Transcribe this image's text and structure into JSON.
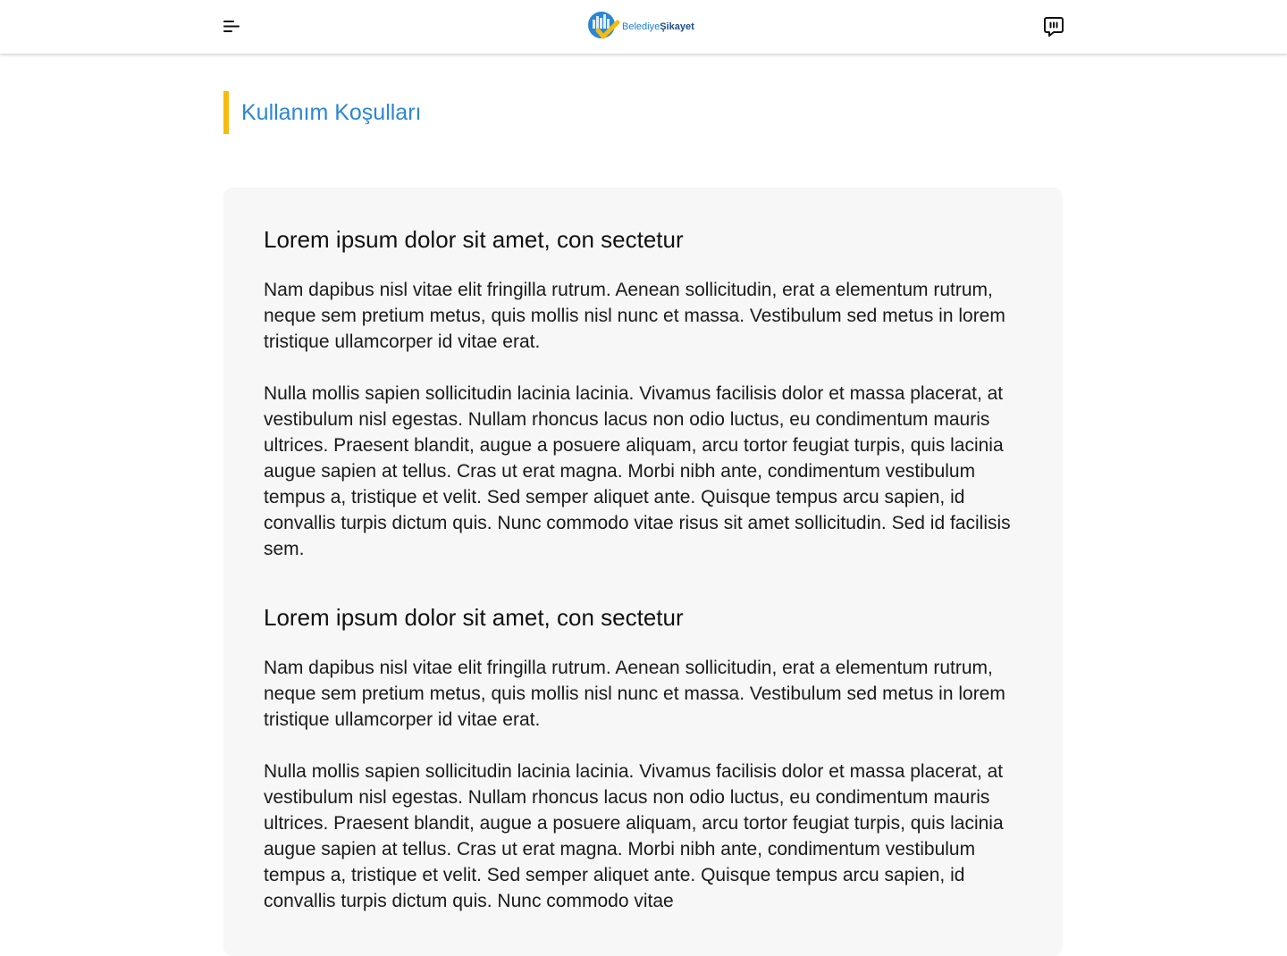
{
  "header": {
    "logo_text_regular": "Belediye",
    "logo_text_bold": "Şikayet",
    "colors": {
      "brand_blue": "#2b86d4",
      "brand_yellow": "#f6bb0e",
      "brand_dark": "#1b4f8f"
    },
    "icons": {
      "menu": "hamburger-menu-icon",
      "feedback": "feedback-chat-icon",
      "logo": "city-checkmark-logo"
    }
  },
  "page": {
    "title": "Kullanım Koşulları",
    "accent_color": "#f6bb0e"
  },
  "sections": [
    {
      "heading": "Lorem ipsum dolor sit amet, con sectetur",
      "paragraphs": [
        "Nam dapibus nisl vitae elit fringilla rutrum. Aenean sollicitudin, erat a elementum rutrum, neque sem pretium metus, quis mollis nisl nunc et massa. Vestibulum sed metus in lorem tristique ullamcorper id vitae erat.",
        "Nulla mollis sapien sollicitudin lacinia lacinia. Vivamus facilisis dolor et massa placerat, at vestibulum nisl egestas. Nullam rhoncus lacus non odio luctus, eu condimentum mauris ultrices. Praesent blandit, augue a posuere aliquam, arcu tortor feugiat turpis, quis lacinia augue sapien at tellus. Cras ut erat magna. Morbi nibh ante, condimentum vestibulum tempus a, tristique et velit. Sed semper aliquet ante. Quisque tempus arcu sapien, id convallis turpis dictum quis. Nunc commodo vitae risus sit amet sollicitudin. Sed id facilisis sem."
      ]
    },
    {
      "heading": "Lorem ipsum dolor sit amet, con sectetur",
      "paragraphs": [
        "Nam dapibus nisl vitae elit fringilla rutrum. Aenean sollicitudin, erat a elementum rutrum, neque sem pretium metus, quis mollis nisl nunc et massa. Vestibulum sed metus in lorem tristique ullamcorper id vitae erat.",
        "Nulla mollis sapien sollicitudin lacinia lacinia. Vivamus facilisis dolor et massa placerat, at vestibulum nisl egestas. Nullam rhoncus lacus non odio luctus, eu condimentum mauris ultrices. Praesent blandit, augue a posuere aliquam, arcu tortor feugiat turpis, quis lacinia augue sapien at tellus. Cras ut erat magna. Morbi nibh ante, condimentum vestibulum tempus a, tristique et velit. Sed semper aliquet ante. Quisque tempus arcu sapien, id convallis turpis dictum quis. Nunc commodo vitae"
      ]
    }
  ]
}
